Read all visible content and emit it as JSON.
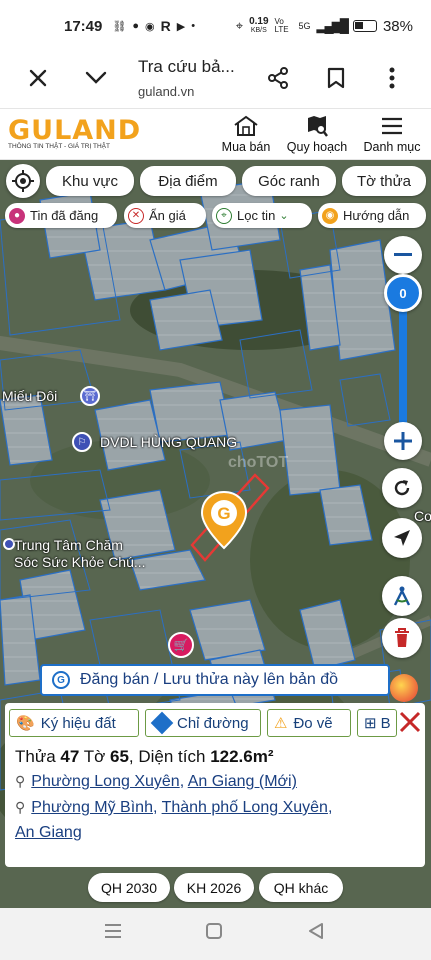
{
  "status": {
    "time": "17:49",
    "net_speed": "0.19",
    "net_unit": "KB/S",
    "volte": "Vo LTE",
    "signal_label": "5G",
    "battery": "38%"
  },
  "browser": {
    "title": "Tra cứu bả...",
    "url": "guland.vn"
  },
  "site": {
    "logo": "GULAND",
    "tagline": "THÔNG TIN THẬT - GIÁ TRỊ THẬT",
    "nav": [
      {
        "label": "Mua bán",
        "icon": "house-icon"
      },
      {
        "label": "Quy hoạch",
        "icon": "map-search-icon"
      },
      {
        "label": "Danh mục",
        "icon": "menu-icon"
      }
    ]
  },
  "toolbar": {
    "chips": [
      "Khu vực",
      "Địa điểm",
      "Góc ranh",
      "Tờ thửa"
    ],
    "filters": [
      "Tin đã đăng",
      "Ẩn giá",
      "Lọc tin",
      "Hướng dẫn"
    ]
  },
  "map": {
    "zoom_value": "0",
    "labels": {
      "temple": "Miếu Đôi",
      "company": "DVDL HÙNG QUANG",
      "center_line1": "Trung Tâm Chăm",
      "center_line2": "Sóc Sức Khỏe Chú...",
      "edge": "Co",
      "watermark": "choTOT"
    },
    "post_banner": "Đăng bán / Lưu thửa này lên bản đồ"
  },
  "info": {
    "tabs": [
      "Ký hiệu đất",
      "Chỉ đường",
      "Đo vẽ",
      "B"
    ],
    "parcel_prefix": "Thửa ",
    "parcel_no": "47",
    "sheet_prefix": " Tờ ",
    "sheet_no": "65",
    "area_prefix": ", Diện tích ",
    "area": "122.6m²",
    "addr1_ward": "Phường Long Xuyên",
    "addr1_sep": ", ",
    "addr1_province": "An Giang (Mới)",
    "addr2_ward": "Phường Mỹ Bình",
    "addr2_sep": ", ",
    "addr2_city": "Thành phố Long Xuyên",
    "addr2_tail": ",",
    "addr2_province": "An Giang"
  },
  "plans": [
    "QH 2030",
    "KH 2026",
    "QH khác"
  ],
  "colors": {
    "brand": "#f2a21d",
    "accent": "#1e6fc8",
    "zoom_track": "#1a7ae0",
    "parcel_outline": "#e53935"
  }
}
